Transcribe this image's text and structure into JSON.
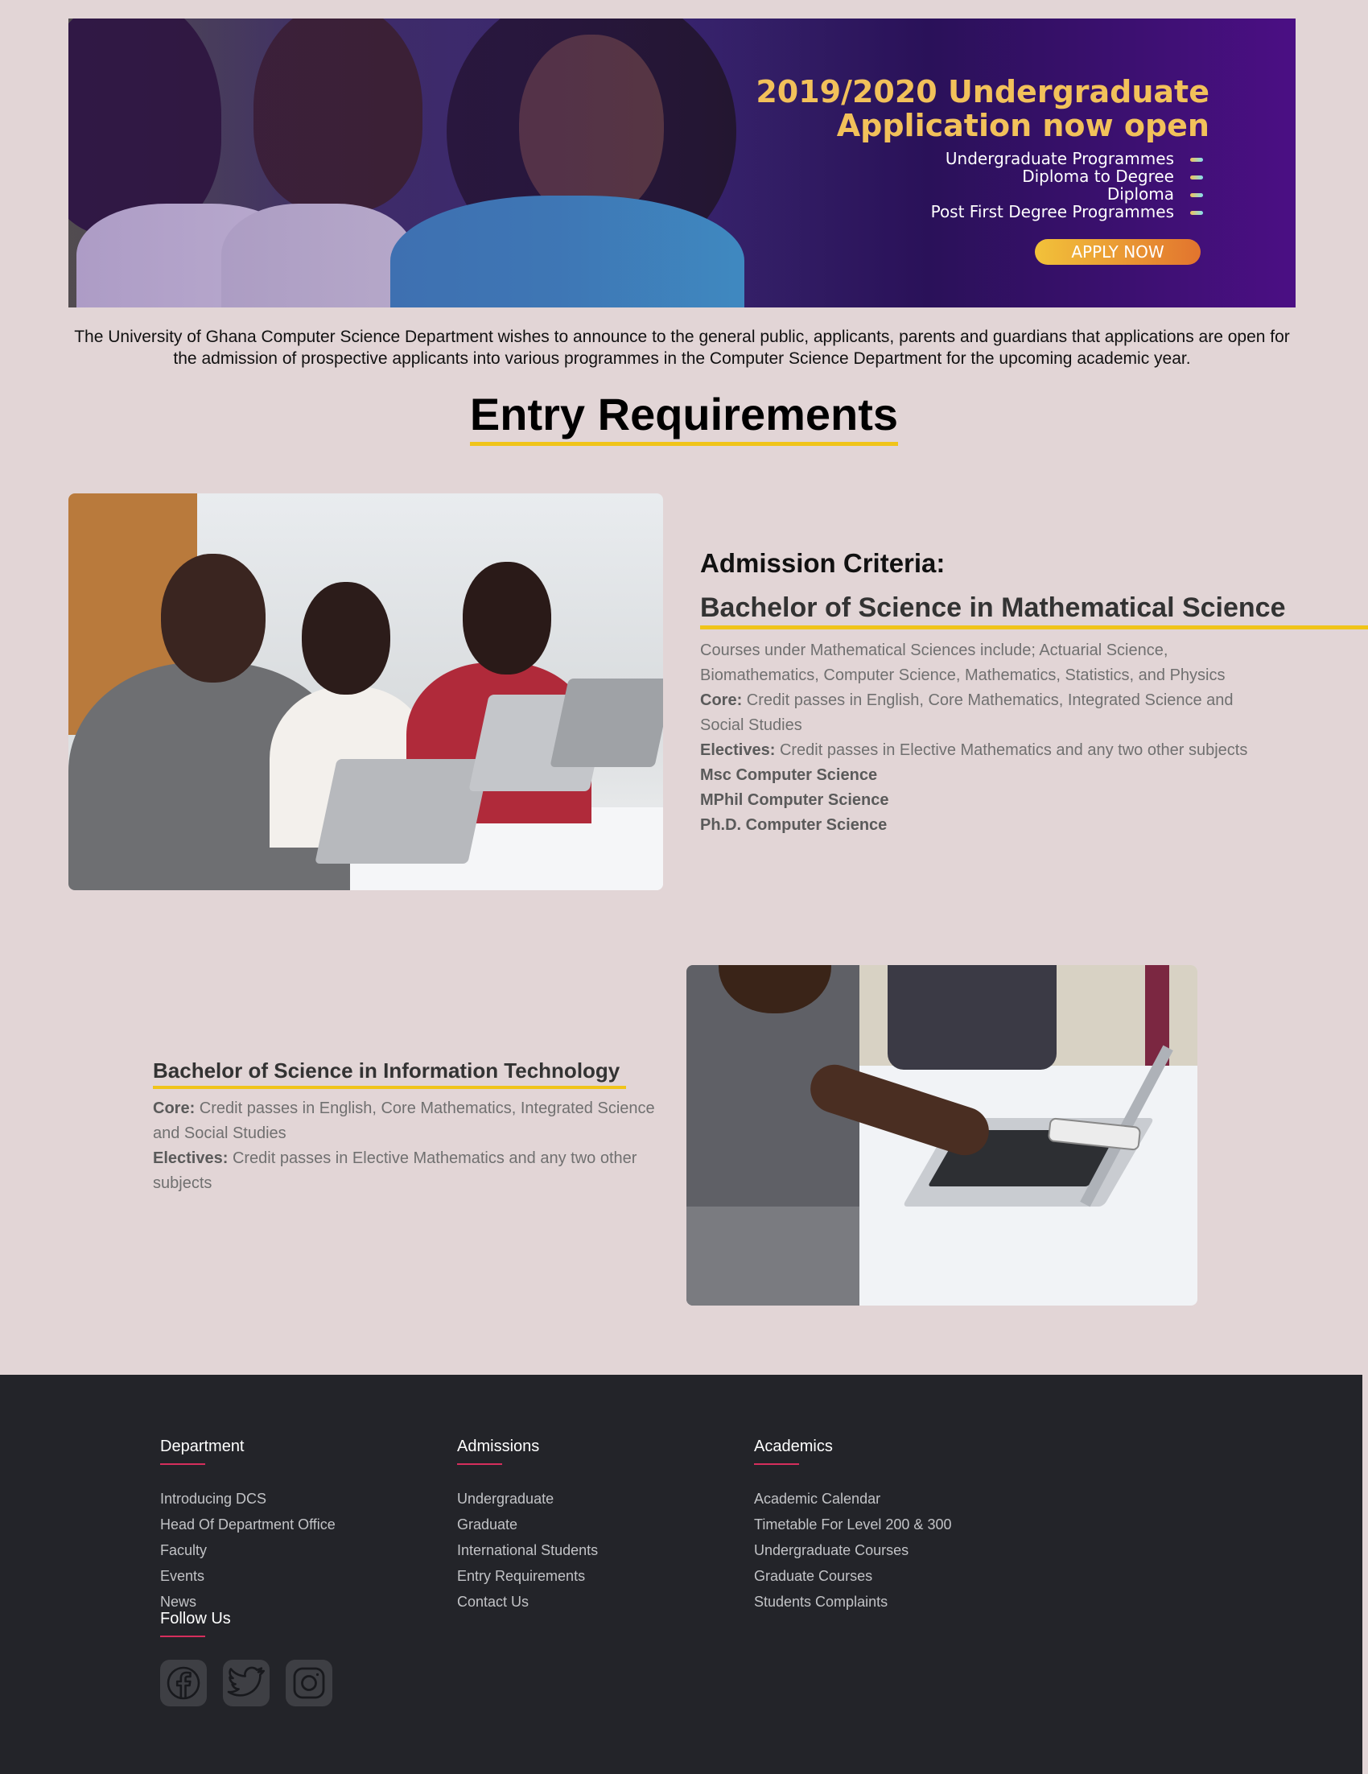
{
  "banner": {
    "title_line1": "2019/2020 Undergraduate",
    "title_line2": "Application now open",
    "programmes": [
      "Undergraduate Programmes",
      "Diploma to Degree",
      "Diploma",
      "Post First Degree Programmes"
    ],
    "apply_label": "APPLY NOW"
  },
  "intro": "The University of Ghana Computer Science Department wishes to announce to the general public, applicants, parents and guardians that applications are open for the admission of prospective applicants into various programmes in the Computer Science Department for the upcoming academic year.",
  "page_title": "Entry Requirements",
  "section1": {
    "heading": "Admission Criteria:",
    "degree": "Bachelor of Science in Mathematical Science",
    "courses": "Courses under Mathematical Sciences include; Actuarial Science, Biomathematics, Computer Science, Mathematics, Statistics, and Physics",
    "core_label": "Core:",
    "core_text": "Credit passes in English, Core Mathematics, Integrated Science and Social Studies",
    "electives_label": "Electives:",
    "electives_text": "Credit passes in Elective Mathematics and any two other subjects",
    "extra": [
      "Msc Computer Science",
      "MPhil Computer Science",
      "Ph.D. Computer Science"
    ]
  },
  "section2": {
    "degree": "Bachelor of Science in Information Technology",
    "core_label": "Core:",
    "core_text": "Credit passes in English, Core Mathematics, Integrated Science and Social Studies",
    "electives_label": "Electives:",
    "electives_text": "Credit passes in Elective Mathematics and any two other subjects"
  },
  "footer": {
    "department": {
      "title": "Department",
      "links": [
        "Introducing DCS",
        "Head Of Department Office",
        "Faculty",
        "Events",
        "News"
      ]
    },
    "admissions": {
      "title": "Admissions",
      "links": [
        "Undergraduate",
        "Graduate",
        "International Students",
        "Entry Requirements",
        "Contact Us"
      ]
    },
    "academics": {
      "title": "Academics",
      "links": [
        "Academic Calendar",
        "Timetable For Level 200 & 300",
        "Undergraduate Courses",
        "Graduate Courses",
        "Students Complaints"
      ]
    },
    "follow_title": "Follow Us",
    "social_icons": [
      "facebook-icon",
      "twitter-icon",
      "instagram-icon"
    ]
  },
  "colors": {
    "background": "#e2d5d6",
    "accent_yellow": "#f0c419",
    "footer_bg": "#232429",
    "footer_rule": "#d62e5c"
  }
}
